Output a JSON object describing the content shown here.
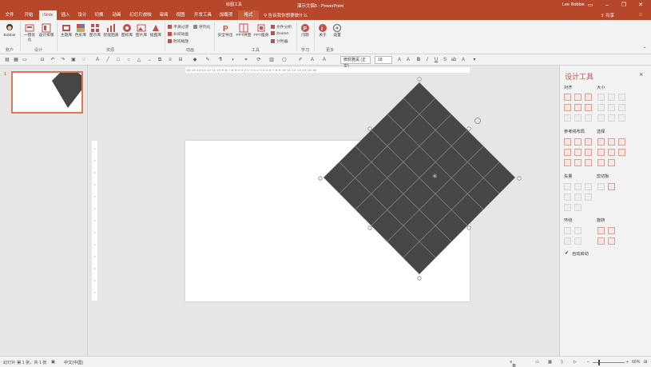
{
  "window": {
    "context_label": "绘图工具",
    "title": "演示文稿5 - PowerPoint",
    "user": "Lee Bobbie",
    "share_label": "共享"
  },
  "tabs": [
    "文件",
    "开始",
    "iSlide",
    "插入",
    "设计",
    "切换",
    "动画",
    "幻灯片放映",
    "审阅",
    "视图",
    "开发工具",
    "加载项",
    "格式"
  ],
  "tell_me": "告诉我你想要做什么",
  "ribbon": {
    "account": {
      "label": "Bobbie",
      "group": "账户"
    },
    "design_group": {
      "buttons": [
        "一键优化",
        "设计排版"
      ],
      "group": "设计"
    },
    "resource_group": {
      "buttons": [
        "主题库",
        "色彩库",
        "图示库",
        "智能图表",
        "图标库",
        "图片库",
        "插图库"
      ],
      "group": "资源"
    },
    "animation_group": {
      "items": [
        "平滑过渡",
        "补间动画",
        "时间缩放",
        "序列化"
      ],
      "group": "动画"
    },
    "tools_group": {
      "buttons": [
        "安全导出",
        "PPT拼图",
        "PPT瘦身"
      ],
      "items": [
        "文件分析",
        "ZoomIt",
        "计时器"
      ],
      "group": "工具"
    },
    "learn_group": {
      "buttons": [
        "问题"
      ],
      "group": "学习"
    },
    "more_group": {
      "buttons": [
        "关于",
        "设置"
      ],
      "group": "更多"
    }
  },
  "qat": {
    "font_name": "微软雅黑 (正文)",
    "font_size": "18"
  },
  "ruler": {
    "h_ticks": "·16·15·14·13·12·11·10·9·8·7·6·5·4·3·2·1·0·1·2·3·4·5·6·7·8·9·10·11·12·13·14·15·16·"
  },
  "thumbnail": {
    "number": "1"
  },
  "pane": {
    "title": "设计工具",
    "sections": [
      "对齐",
      "大小",
      "参考线布局",
      "选择",
      "矢量",
      "剪切板",
      "环绕",
      "旋转"
    ],
    "checkbox_label": "自动启动"
  },
  "status": {
    "slide": "幻灯片 第 1 张，共 1 张",
    "language": "中文(中国)",
    "notes": "备注",
    "zoom": "66%"
  },
  "colors": {
    "accent": "#b7472a",
    "shape": "#454747",
    "pane_title": "#c0504d"
  }
}
